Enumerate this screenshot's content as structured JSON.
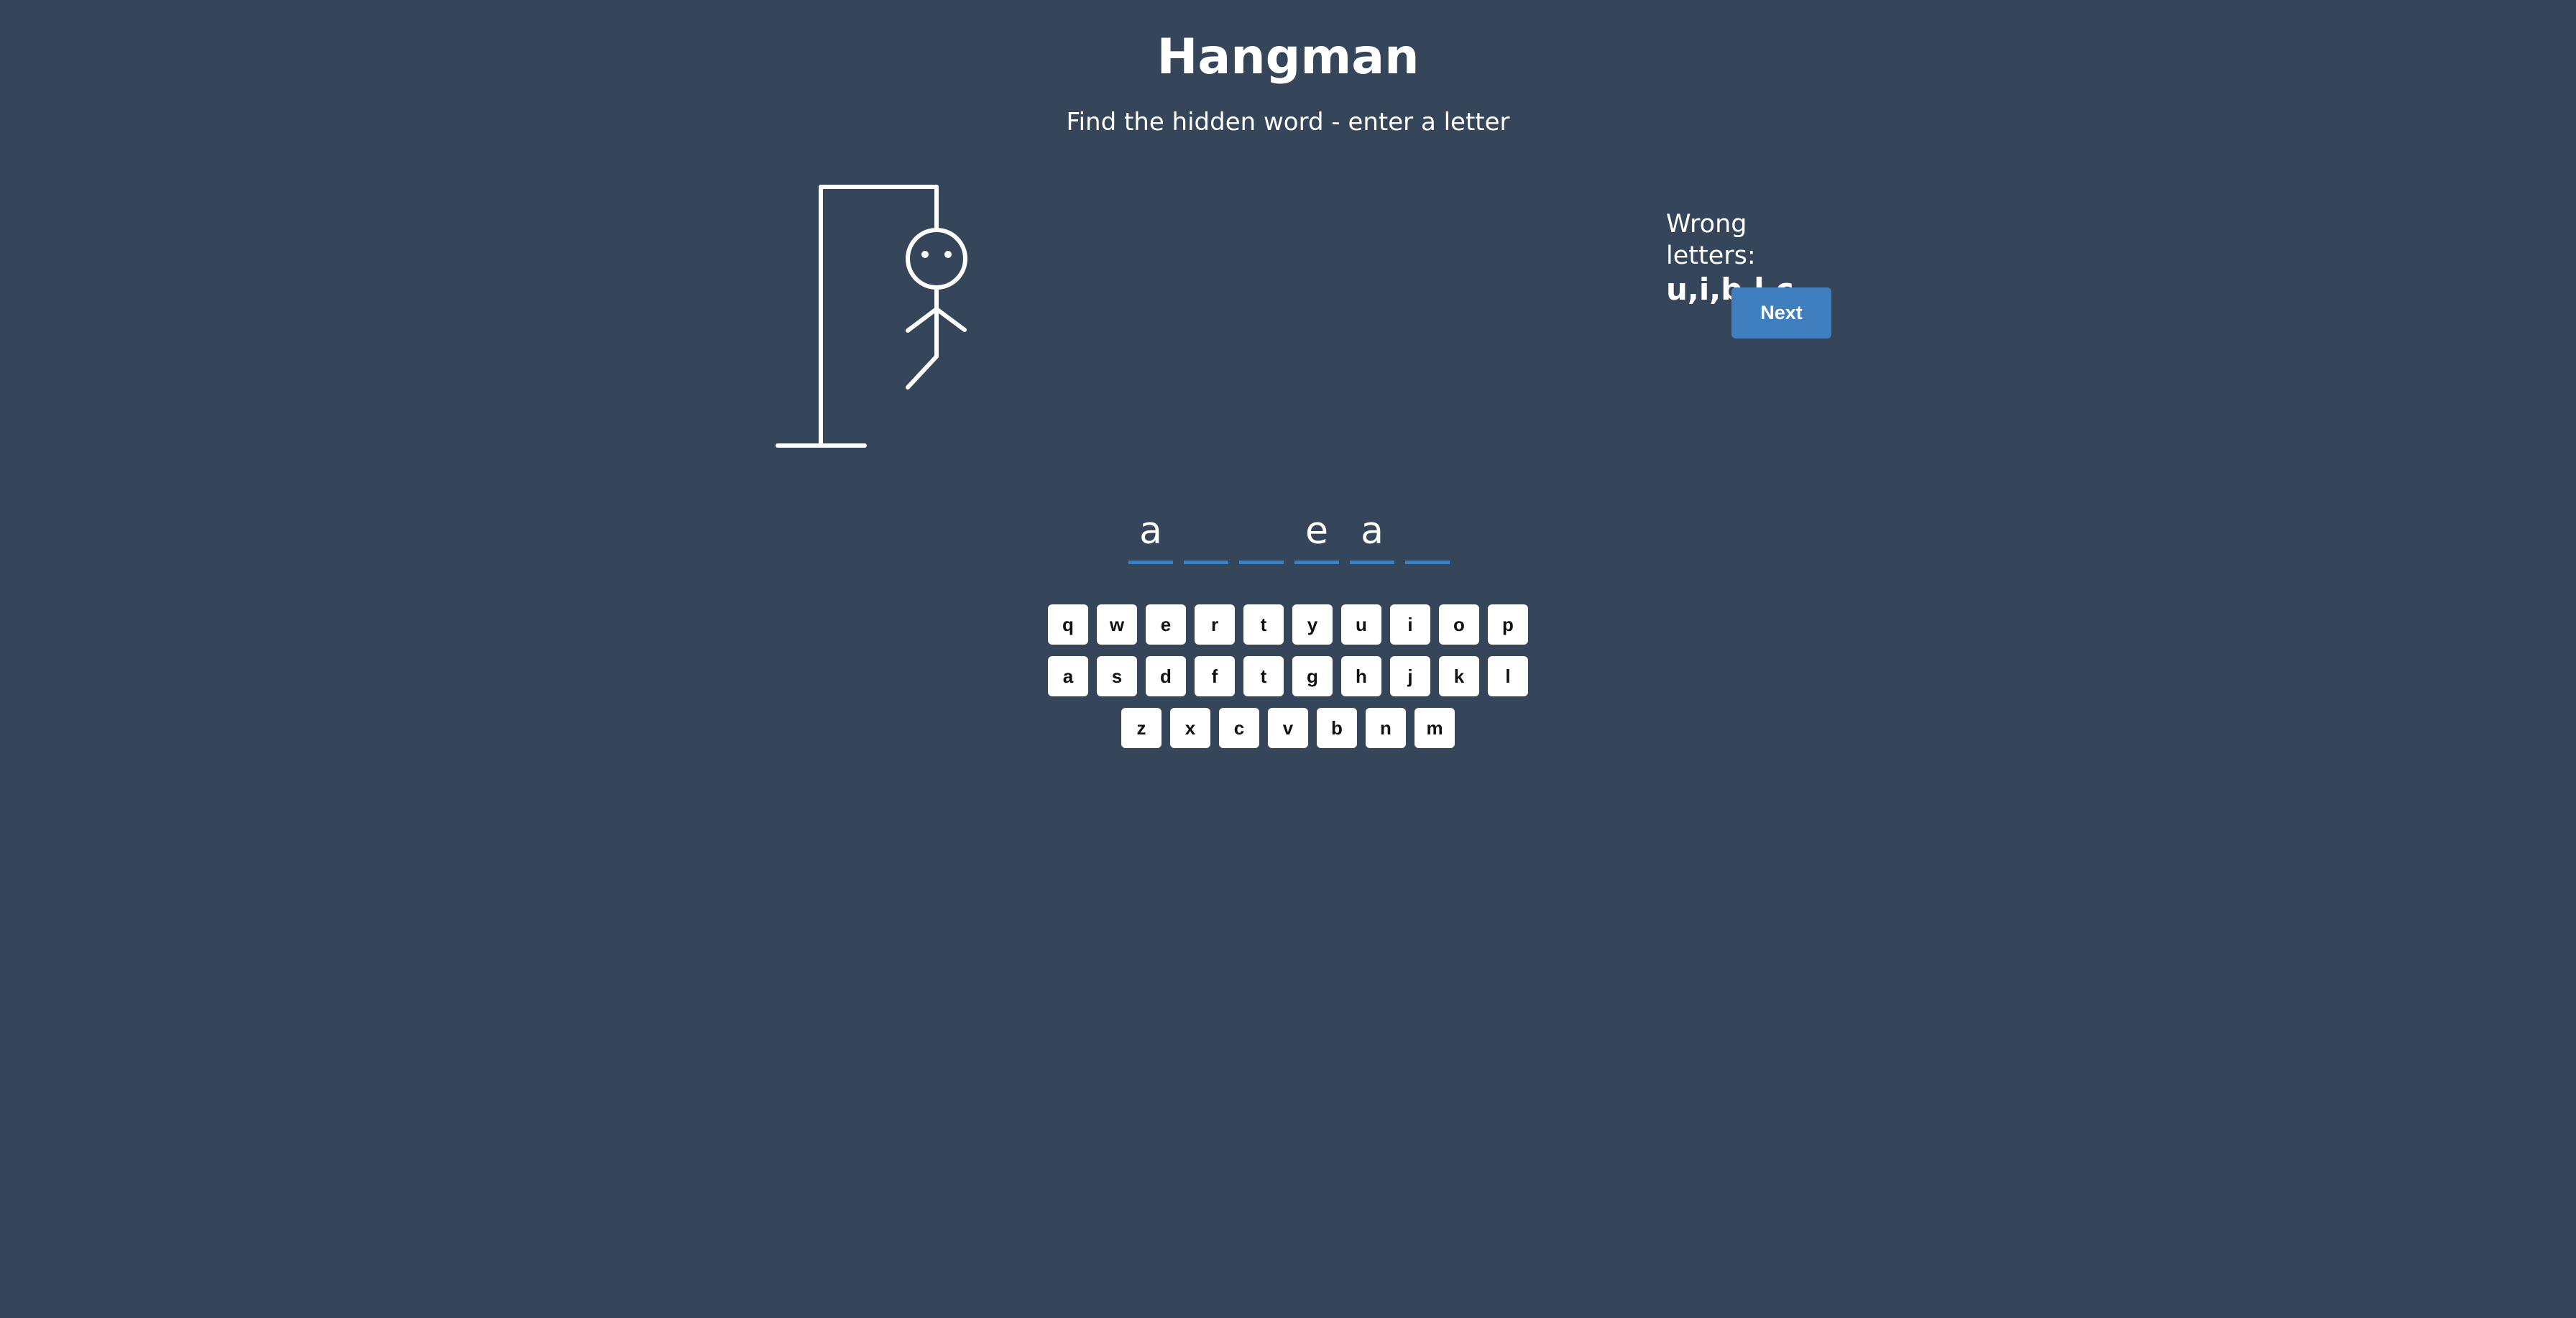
{
  "header": {
    "title": "Hangman",
    "subtitle": "Find the hidden word - enter a letter"
  },
  "wrong_letters": {
    "label": "Wrong letters:",
    "values": "u,i,b,l,c"
  },
  "next_button": {
    "label": "Next"
  },
  "word": {
    "slots": [
      "a",
      "",
      "",
      "e",
      "a",
      ""
    ]
  },
  "keyboard": {
    "rows": [
      [
        "q",
        "w",
        "e",
        "r",
        "t",
        "y",
        "u",
        "i",
        "o",
        "p"
      ],
      [
        "a",
        "s",
        "d",
        "f",
        "t",
        "g",
        "h",
        "j",
        "k",
        "l"
      ],
      [
        "z",
        "x",
        "c",
        "v",
        "b",
        "n",
        "m"
      ]
    ]
  },
  "colors": {
    "background": "#36465a",
    "accent": "#3f7fbf",
    "text": "#ffffff",
    "key_background": "#ffffff"
  },
  "hangman": {
    "parts_shown": [
      "head",
      "eyes",
      "body",
      "left-arm",
      "right-arm",
      "left-leg"
    ]
  }
}
